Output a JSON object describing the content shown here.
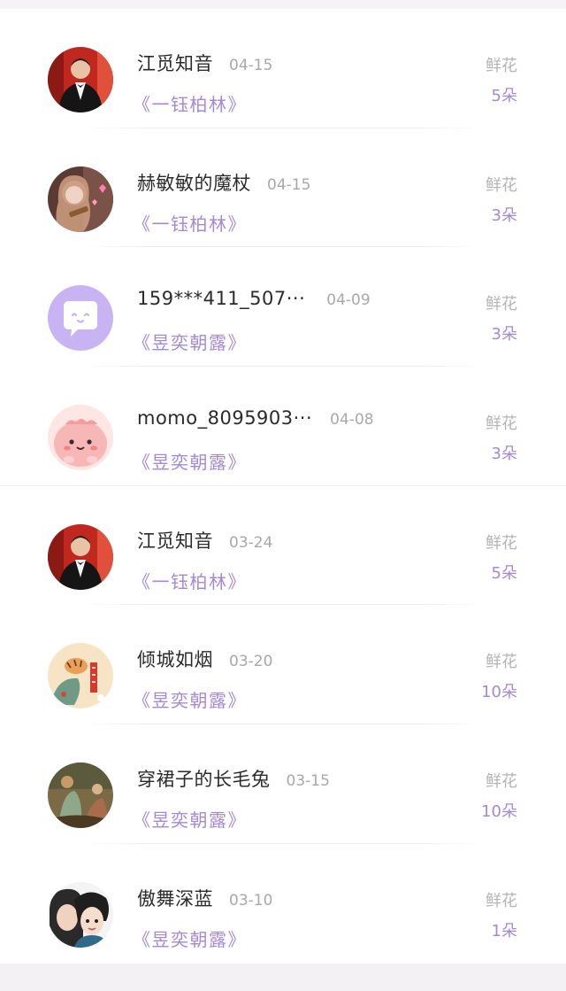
{
  "entries": [
    {
      "username": "江觅知音",
      "date": "04-15",
      "book": "《一钰柏林》",
      "gift_label": "鲜花",
      "gift_count": "5朵",
      "avatar": "man-in-tuxedo"
    },
    {
      "username": "赫敏敏的魔杖",
      "date": "04-15",
      "book": "《一钰柏林》",
      "gift_label": "鲜花",
      "gift_count": "3朵",
      "avatar": "girl-photo"
    },
    {
      "username": "159***411_507···",
      "date": "04-09",
      "book": "《昱奕朝露》",
      "gift_label": "鲜花",
      "gift_count": "3朵",
      "avatar": "default-chat-bubble"
    },
    {
      "username": "momo_8095903···",
      "date": "04-08",
      "book": "《昱奕朝露》",
      "gift_label": "鲜花",
      "gift_count": "3朵",
      "avatar": "pink-cartoon"
    },
    {
      "username": "江觅知音",
      "date": "03-24",
      "book": "《一钰柏林》",
      "gift_label": "鲜花",
      "gift_count": "5朵",
      "avatar": "man-in-tuxedo"
    },
    {
      "username": "倾城如烟",
      "date": "03-20",
      "book": "《昱奕朝露》",
      "gift_label": "鲜花",
      "gift_count": "10朵",
      "avatar": "tiger-illustration"
    },
    {
      "username": "穿裙子的长毛兔",
      "date": "03-15",
      "book": "《昱奕朝露》",
      "gift_label": "鲜花",
      "gift_count": "10朵",
      "avatar": "painting"
    },
    {
      "username": "傲舞深蓝",
      "date": "03-10",
      "book": "《昱奕朝露》",
      "gift_label": "鲜花",
      "gift_count": "1朵",
      "avatar": "anime-couple"
    }
  ],
  "colors": {
    "accent": "#a489d6",
    "username": "#2b2b2b",
    "muted": "#a8a8a8",
    "default_avatar": "#c9b4f3"
  }
}
